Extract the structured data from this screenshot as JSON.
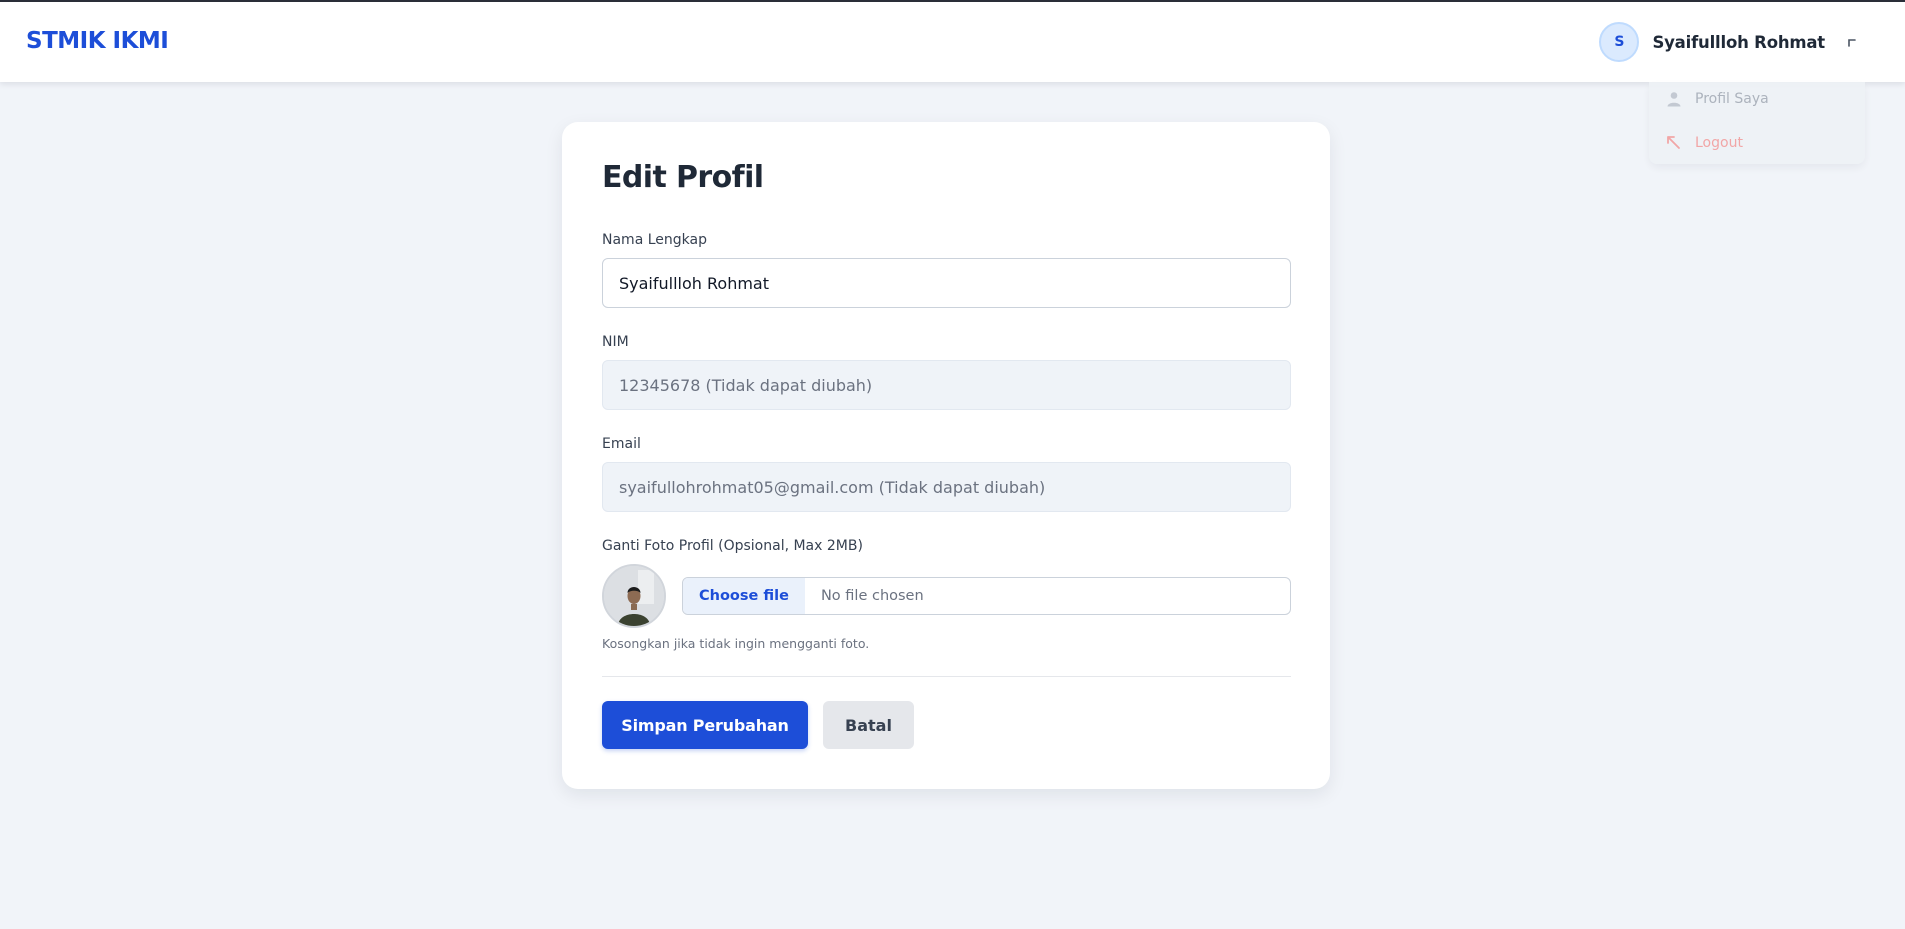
{
  "navbar": {
    "brand": "STMIK IKMI",
    "user": {
      "initial": "S",
      "name": "Syaifullloh Rohmat"
    },
    "dropdown": {
      "profile_label": "Profil Saya",
      "logout_label": "Logout"
    }
  },
  "form": {
    "title": "Edit Profil",
    "full_name": {
      "label": "Nama Lengkap",
      "value": "Syaifullloh Rohmat"
    },
    "nim": {
      "label": "NIM",
      "value": "12345678 (Tidak dapat diubah)"
    },
    "email": {
      "label": "Email",
      "value": "syaifullohrohmat05@gmail.com (Tidak dapat diubah)"
    },
    "photo": {
      "label": "Ganti Foto Profil (Opsional, Max 2MB)",
      "choose_label": "Choose file",
      "status": "No file chosen",
      "hint": "Kosongkan jika tidak ingin mengganti foto."
    },
    "save_label": "Simpan Perubahan",
    "cancel_label": "Batal"
  },
  "colors": {
    "accent": "#1d4ed8",
    "background": "#f1f4f9",
    "logout": "#f2a0a0"
  },
  "icons": {
    "caret": "caret-icon",
    "profile": "user-icon",
    "logout": "logout-icon"
  }
}
